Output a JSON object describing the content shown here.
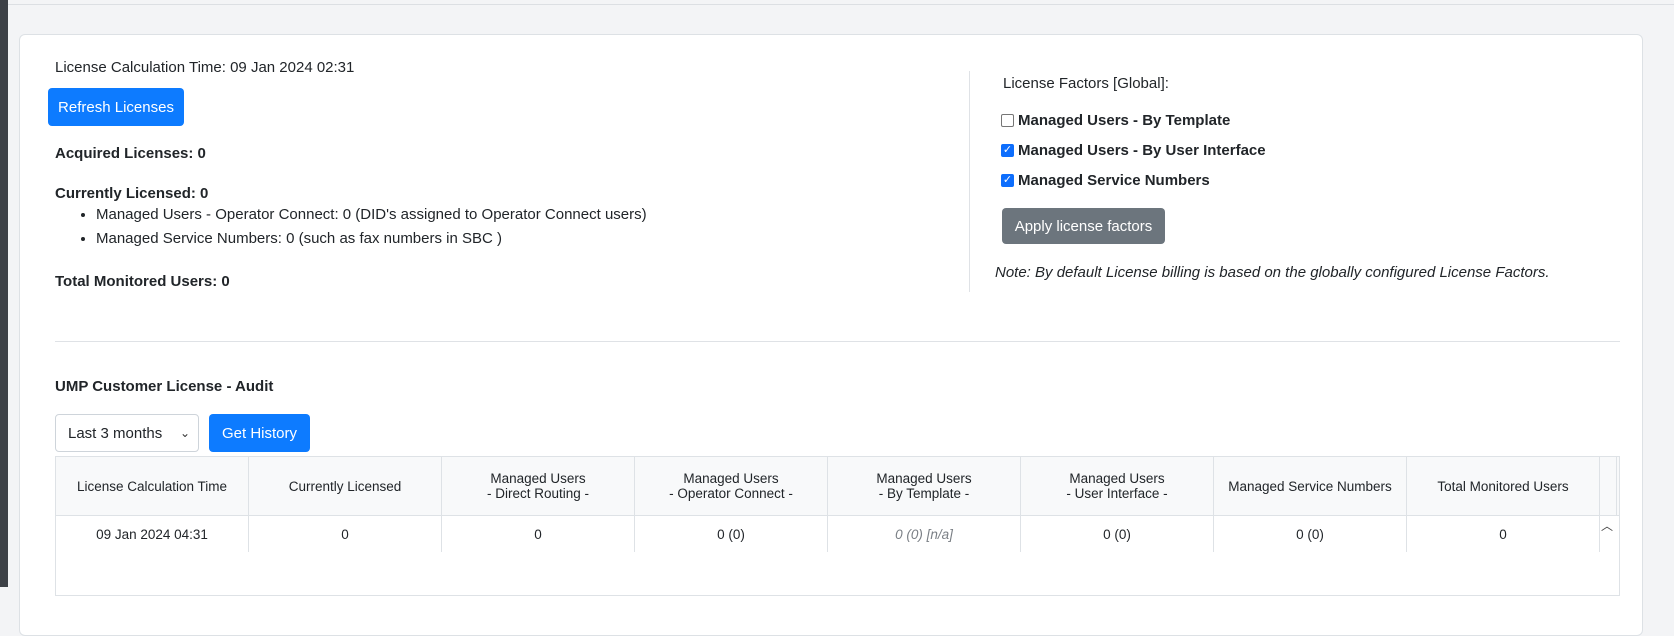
{
  "license": {
    "calculation_time": "License Calculation Time: 09 Jan 2024 02:31",
    "refresh_label": "Refresh Licenses",
    "acquired": "Acquired Licenses: 0",
    "currently_licensed": "Currently Licensed: 0",
    "bullets": [
      "Managed Users - Operator Connect: 0 (DID's assigned to Operator Connect users)",
      "Managed Service Numbers: 0 (such as fax numbers in SBC )"
    ],
    "total_monitored": "Total Monitored Users: 0"
  },
  "factors": {
    "title": "License Factors [Global]:",
    "items": [
      {
        "label": "Managed Users - By Template",
        "checked": false
      },
      {
        "label": "Managed Users - By User Interface",
        "checked": true
      },
      {
        "label": "Managed Service Numbers",
        "checked": true
      }
    ],
    "apply_label": "Apply license factors",
    "note": "Note:  By default License billing is based on the globally configured License Factors."
  },
  "audit": {
    "title": "UMP Customer License - Audit",
    "period": "Last 3 months",
    "history_label": "Get History",
    "columns": [
      [
        "License Calculation Time"
      ],
      [
        "Currently Licensed"
      ],
      [
        "Managed Users",
        "- Direct Routing -"
      ],
      [
        "Managed Users",
        "- Operator Connect -"
      ],
      [
        "Managed Users",
        "- By Template -"
      ],
      [
        "Managed Users",
        "- User Interface -"
      ],
      [
        "Managed Service Numbers"
      ],
      [
        "Total Monitored Users"
      ]
    ],
    "rows": [
      [
        "09 Jan 2024 04:31",
        "0",
        "0",
        "0 (0)",
        "0 (0) [n/a]",
        "0 (0)",
        "0 (0)",
        "0"
      ]
    ]
  }
}
